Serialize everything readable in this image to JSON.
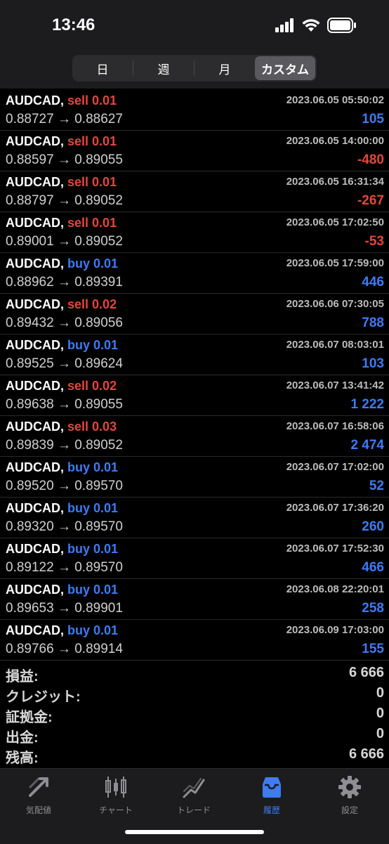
{
  "status_bar": {
    "time": "13:46"
  },
  "period_tabs": [
    {
      "label": "日",
      "active": false
    },
    {
      "label": "週",
      "active": false
    },
    {
      "label": "月",
      "active": false
    },
    {
      "label": "カスタム",
      "active": true
    }
  ],
  "trades": [
    {
      "symbol": "AUDCAD,",
      "side": "sell",
      "side_label": "sell 0.01",
      "prices": "0.88727 → 0.88627",
      "datetime": "2023.06.05 05:50:02",
      "profit": "105"
    },
    {
      "symbol": "AUDCAD,",
      "side": "sell",
      "side_label": "sell 0.01",
      "prices": "0.88597 → 0.89055",
      "datetime": "2023.06.05 14:00:00",
      "profit": "-480"
    },
    {
      "symbol": "AUDCAD,",
      "side": "sell",
      "side_label": "sell 0.01",
      "prices": "0.88797 → 0.89052",
      "datetime": "2023.06.05 16:31:34",
      "profit": "-267"
    },
    {
      "symbol": "AUDCAD,",
      "side": "sell",
      "side_label": "sell 0.01",
      "prices": "0.89001 → 0.89052",
      "datetime": "2023.06.05 17:02:50",
      "profit": "-53"
    },
    {
      "symbol": "AUDCAD,",
      "side": "buy",
      "side_label": "buy 0.01",
      "prices": "0.88962 → 0.89391",
      "datetime": "2023.06.05 17:59:00",
      "profit": "446"
    },
    {
      "symbol": "AUDCAD,",
      "side": "sell",
      "side_label": "sell 0.02",
      "prices": "0.89432 → 0.89056",
      "datetime": "2023.06.06 07:30:05",
      "profit": "788"
    },
    {
      "symbol": "AUDCAD,",
      "side": "buy",
      "side_label": "buy 0.01",
      "prices": "0.89525 → 0.89624",
      "datetime": "2023.06.07 08:03:01",
      "profit": "103"
    },
    {
      "symbol": "AUDCAD,",
      "side": "sell",
      "side_label": "sell 0.02",
      "prices": "0.89638 → 0.89055",
      "datetime": "2023.06.07 13:41:42",
      "profit": "1 222"
    },
    {
      "symbol": "AUDCAD,",
      "side": "sell",
      "side_label": "sell 0.03",
      "prices": "0.89839 → 0.89052",
      "datetime": "2023.06.07 16:58:06",
      "profit": "2 474"
    },
    {
      "symbol": "AUDCAD,",
      "side": "buy",
      "side_label": "buy 0.01",
      "prices": "0.89520 → 0.89570",
      "datetime": "2023.06.07 17:02:00",
      "profit": "52"
    },
    {
      "symbol": "AUDCAD,",
      "side": "buy",
      "side_label": "buy 0.01",
      "prices": "0.89320 → 0.89570",
      "datetime": "2023.06.07 17:36:20",
      "profit": "260"
    },
    {
      "symbol": "AUDCAD,",
      "side": "buy",
      "side_label": "buy 0.01",
      "prices": "0.89122 → 0.89570",
      "datetime": "2023.06.07 17:52:30",
      "profit": "466"
    },
    {
      "symbol": "AUDCAD,",
      "side": "buy",
      "side_label": "buy 0.01",
      "prices": "0.89653 → 0.89901",
      "datetime": "2023.06.08 22:20:01",
      "profit": "258"
    },
    {
      "symbol": "AUDCAD,",
      "side": "buy",
      "side_label": "buy 0.01",
      "prices": "0.89766 → 0.89914",
      "datetime": "2023.06.09 17:03:00",
      "profit": "155"
    }
  ],
  "summary": [
    {
      "label": "損益:",
      "value": "6 666"
    },
    {
      "label": "クレジット:",
      "value": "0"
    },
    {
      "label": "証拠金:",
      "value": "0"
    },
    {
      "label": "出金:",
      "value": "0"
    },
    {
      "label": "残高:",
      "value": "6 666"
    }
  ],
  "tab_bar": [
    {
      "label": "気配値",
      "icon": "quotes-icon",
      "active": false
    },
    {
      "label": "チャート",
      "icon": "chart-icon",
      "active": false
    },
    {
      "label": "トレード",
      "icon": "trade-icon",
      "active": false
    },
    {
      "label": "履歴",
      "icon": "history-icon",
      "active": true
    },
    {
      "label": "設定",
      "icon": "settings-icon",
      "active": false
    }
  ],
  "colors": {
    "sell": "#e4473b",
    "buy": "#3e7bf5",
    "accent": "#3e7bf5"
  }
}
